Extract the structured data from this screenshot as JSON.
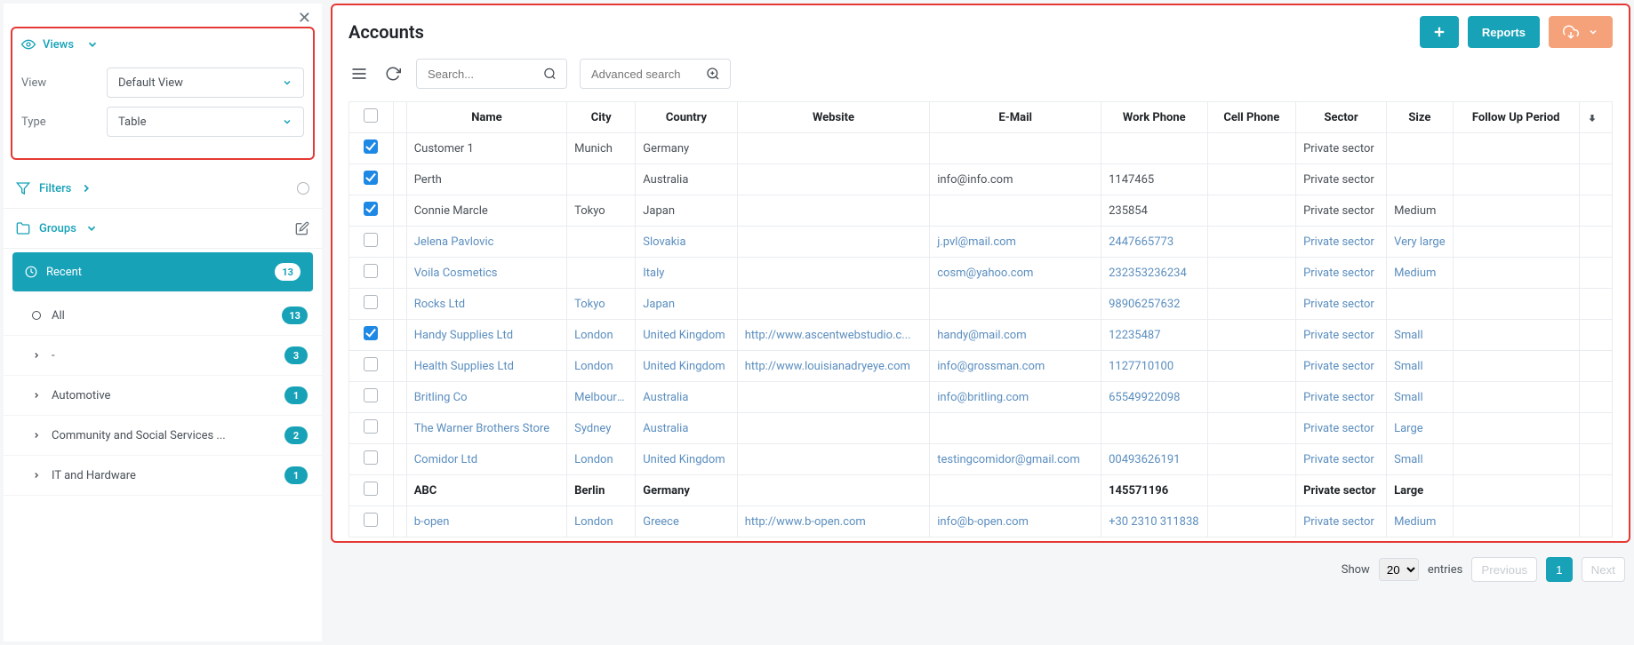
{
  "sidebar": {
    "views": {
      "header": "Views",
      "view_label": "View",
      "view_value": "Default View",
      "type_label": "Type",
      "type_value": "Table"
    },
    "filters": {
      "header": "Filters"
    },
    "groups": {
      "header": "Groups",
      "items": [
        {
          "label": "Recent",
          "count": "13",
          "active": true,
          "icon": "clock"
        },
        {
          "label": "All",
          "count": "13",
          "icon": "circle"
        },
        {
          "label": "-",
          "count": "3",
          "icon": "chevron"
        },
        {
          "label": "Automotive",
          "count": "1",
          "icon": "chevron"
        },
        {
          "label": "Community and Social Services ...",
          "count": "2",
          "icon": "chevron"
        },
        {
          "label": "IT and Hardware",
          "count": "1",
          "icon": "chevron"
        }
      ]
    }
  },
  "page": {
    "title": "Accounts",
    "reports_label": "Reports",
    "search_placeholder": "Search...",
    "adv_search_placeholder": "Advanced search"
  },
  "table": {
    "columns": [
      "",
      "",
      "Name",
      "City",
      "Country",
      "Website",
      "E-Mail",
      "Work Phone",
      "Cell Phone",
      "Sector",
      "Size",
      "Follow Up Period",
      ""
    ],
    "rows": [
      {
        "checked": true,
        "name": "Customer 1",
        "city": "Munich",
        "country": "Germany",
        "website": "",
        "email": "",
        "wphone": "",
        "cphone": "",
        "sector": "Private sector",
        "size": "",
        "follow": ""
      },
      {
        "checked": true,
        "name": "Perth",
        "city": "",
        "country": "Australia",
        "website": "",
        "email": "info@info.com",
        "wphone": "1147465",
        "cphone": "",
        "sector": "Private sector",
        "size": "",
        "follow": ""
      },
      {
        "checked": true,
        "name": "Connie Marcle",
        "city": "Tokyo",
        "country": "Japan",
        "website": "",
        "email": "",
        "wphone": "235854",
        "cphone": "",
        "sector": "Private sector",
        "size": "Medium",
        "follow": ""
      },
      {
        "checked": false,
        "link": true,
        "name": "Jelena Pavlovic",
        "city": "",
        "country": "Slovakia",
        "website": "",
        "email": "j.pvl@mail.com",
        "wphone": "2447665773",
        "cphone": "",
        "sector": "Private sector",
        "size": "Very large",
        "follow": ""
      },
      {
        "checked": false,
        "link": true,
        "name": "Voila Cosmetics",
        "city": "",
        "country": "Italy",
        "website": "",
        "email": "cosm@yahoo.com",
        "wphone": "232353236234",
        "cphone": "",
        "sector": "Private sector",
        "size": "Medium",
        "follow": ""
      },
      {
        "checked": false,
        "link": true,
        "name": "Rocks Ltd",
        "city": "Tokyo",
        "country": "Japan",
        "website": "",
        "email": "",
        "wphone": "98906257632",
        "cphone": "",
        "sector": "Private sector",
        "size": "",
        "follow": ""
      },
      {
        "checked": true,
        "link": true,
        "name": "Handy Supplies Ltd",
        "city": "London",
        "country": "United Kingdom",
        "website": "http://www.ascentwebstudio.c...",
        "email": "handy@mail.com",
        "wphone": "12235487",
        "cphone": "",
        "sector": "Private sector",
        "size": "Small",
        "follow": ""
      },
      {
        "checked": false,
        "link": true,
        "name": "Health Supplies Ltd",
        "city": "London",
        "country": "United Kingdom",
        "website": "http://www.louisianadryeye.com",
        "email": "info@grossman.com",
        "wphone": "1127710100",
        "cphone": "",
        "sector": "Private sector",
        "size": "Small",
        "follow": ""
      },
      {
        "checked": false,
        "link": true,
        "name": "Britling Co",
        "city": "Melbourne",
        "country": "Australia",
        "website": "",
        "email": "info@britling.com",
        "wphone": "65549922098",
        "cphone": "",
        "sector": "Private sector",
        "size": "Small",
        "follow": ""
      },
      {
        "checked": false,
        "link": true,
        "name": "The Warner Brothers Store",
        "city": "Sydney",
        "country": "Australia",
        "website": "",
        "email": "",
        "wphone": "",
        "cphone": "",
        "sector": "Private sector",
        "size": "Large",
        "follow": ""
      },
      {
        "checked": false,
        "link": true,
        "name": "Comidor Ltd",
        "city": "London",
        "country": "United Kingdom",
        "website": "",
        "email": "testingcomidor@gmail.com",
        "wphone": "00493626191",
        "cphone": "",
        "sector": "Private sector",
        "size": "Small",
        "follow": ""
      },
      {
        "checked": false,
        "bold": true,
        "name": "ABC",
        "city": "Berlin",
        "country": "Germany",
        "website": "",
        "email": "",
        "wphone": "145571196",
        "cphone": "",
        "sector": "Private sector",
        "size": "Large",
        "follow": ""
      },
      {
        "checked": false,
        "link": true,
        "name": "b-open",
        "city": "London",
        "country": "Greece",
        "website": "http://www.b-open.com",
        "email": "info@b-open.com",
        "wphone": "+30 2310 311838",
        "cphone": "",
        "sector": "Private sector",
        "size": "Medium",
        "follow": ""
      }
    ]
  },
  "pager": {
    "show": "Show",
    "size": "20",
    "entries": "entries",
    "prev": "Previous",
    "page": "1",
    "next": "Next"
  }
}
